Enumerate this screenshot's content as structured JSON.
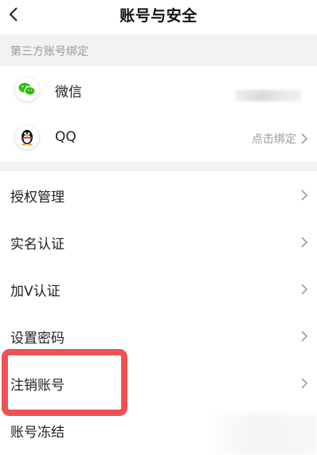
{
  "header": {
    "title": "账号与安全",
    "back_icon": "chevron-left-icon"
  },
  "third_party": {
    "section_title": "第三方账号绑定",
    "items": [
      {
        "label": "微信",
        "icon": "wechat-icon",
        "icon_color": "#2dc100"
      },
      {
        "label": "QQ",
        "icon": "qq-penguin-icon",
        "status": "点击绑定"
      }
    ]
  },
  "menu": {
    "items": [
      {
        "label": "授权管理"
      },
      {
        "label": "实名认证"
      },
      {
        "label": "加V认证"
      },
      {
        "label": "设置密码"
      },
      {
        "label": "注销账号"
      },
      {
        "label": "账号冻结"
      }
    ]
  },
  "colors": {
    "highlight": "#ee5252",
    "muted_text": "#9a9a9a",
    "section_bg": "#f2f2f2"
  }
}
